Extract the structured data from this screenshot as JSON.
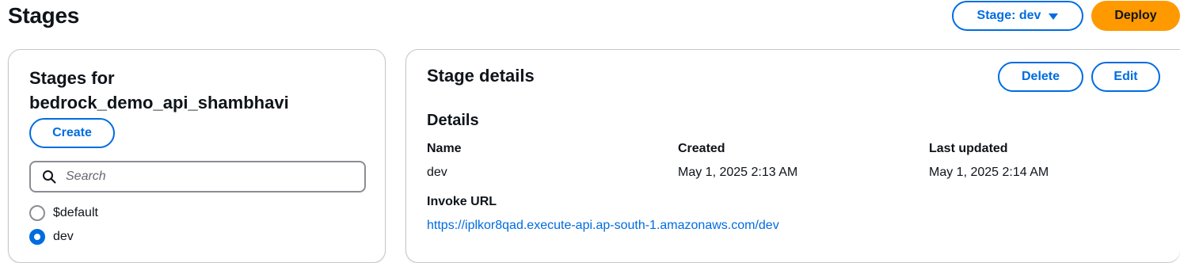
{
  "header": {
    "title": "Stages",
    "stage_selector_label": "Stage: dev",
    "deploy_label": "Deploy"
  },
  "left_panel": {
    "title_line1": "Stages for",
    "title_line2": "bedrock_demo_api_shambhavi",
    "create_label": "Create",
    "search": {
      "placeholder": "Search",
      "value": ""
    },
    "stages": [
      {
        "name": "$default",
        "selected": false
      },
      {
        "name": "dev",
        "selected": true
      }
    ]
  },
  "right_panel": {
    "title": "Stage details",
    "delete_label": "Delete",
    "edit_label": "Edit",
    "details_heading": "Details",
    "fields": {
      "name_label": "Name",
      "name_value": "dev",
      "created_label": "Created",
      "created_value": "May 1, 2025 2:13 AM",
      "updated_label": "Last updated",
      "updated_value": "May 1, 2025 2:14 AM",
      "invoke_label": "Invoke URL",
      "invoke_value": "https://iplkor8qad.execute-api.ap-south-1.amazonaws.com/dev"
    }
  },
  "colors": {
    "accent": "#006ce0",
    "primary_button": "#ff9900",
    "text": "#0f141a",
    "border": "#c6c6cd"
  },
  "icons": {
    "search": "search-icon",
    "dropdown": "caret-down-icon"
  }
}
